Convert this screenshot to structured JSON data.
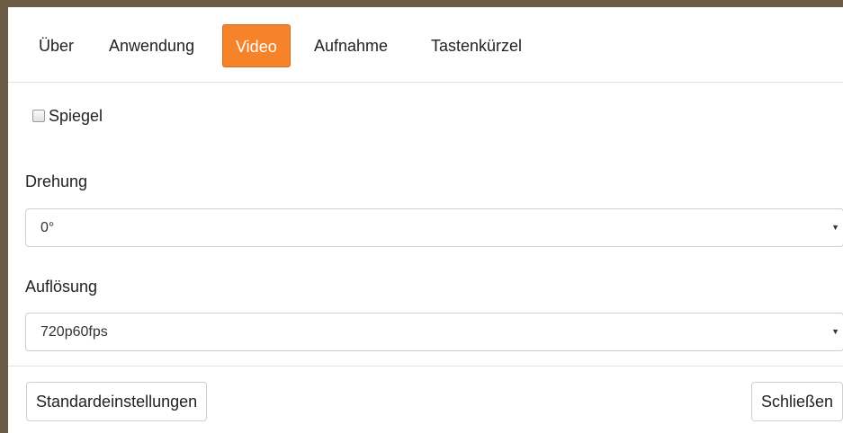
{
  "tabs": [
    {
      "label": "Über"
    },
    {
      "label": "Anwendung"
    },
    {
      "label": "Video",
      "active": true
    },
    {
      "label": "Aufnahme"
    },
    {
      "label": "Tastenkürzel"
    }
  ],
  "mirror": {
    "label": "Spiegel",
    "checked": false
  },
  "rotation": {
    "label": "Drehung",
    "value": "0°"
  },
  "resolution": {
    "label": "Auflösung",
    "value": "720p60fps"
  },
  "footer": {
    "defaults_label": "Standardeinstellungen",
    "close_label": "Schließen"
  },
  "colors": {
    "accent": "#f6832a",
    "backdrop": "#6b5a44"
  }
}
